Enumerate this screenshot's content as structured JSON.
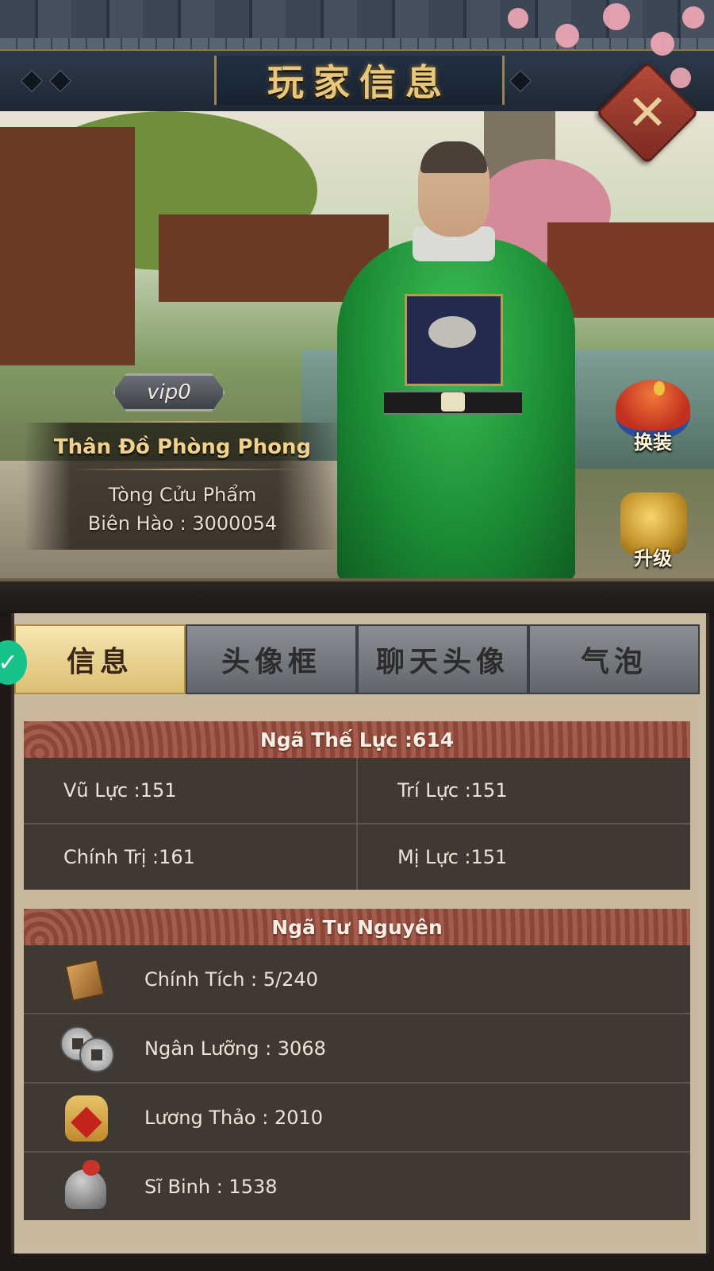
{
  "header": {
    "title": "玩家信息",
    "close_icon": "close-icon"
  },
  "player": {
    "vip": "vip0",
    "name": "Thân Đồ Phòng Phong",
    "rank": "Tòng Cửu Phẩm",
    "id_text": "Biên Hào : 3000054"
  },
  "actions": {
    "change_outfit": "换装",
    "upgrade": "升级"
  },
  "tabs": [
    {
      "label": "信息",
      "active": true
    },
    {
      "label": "头像框",
      "active": false
    },
    {
      "label": "聊天头像",
      "active": false
    },
    {
      "label": "气泡",
      "active": false
    }
  ],
  "power": {
    "header": "Ngã Thế Lực :614",
    "stats": [
      {
        "label": "Vũ Lực :151"
      },
      {
        "label": "Trí Lực :151"
      },
      {
        "label": "Chính Trị :161"
      },
      {
        "label": "Mị Lực :151"
      }
    ]
  },
  "resources": {
    "header": "Ngã Tư Nguyên",
    "items": [
      {
        "label": "Chính Tích : 5/240",
        "icon": "merit-book-icon"
      },
      {
        "label": "Ngân Lưỡng : 3068",
        "icon": "silver-coins-icon"
      },
      {
        "label": "Lương Thảo : 2010",
        "icon": "grain-bag-icon"
      },
      {
        "label": "Sĩ Binh : 1538",
        "icon": "soldier-helmet-icon"
      }
    ]
  },
  "colors": {
    "accent_gold": "#e8c77a",
    "section_header": "#a45c4e",
    "panel_dark": "#3f3833",
    "robe_green": "#1b8a33"
  }
}
